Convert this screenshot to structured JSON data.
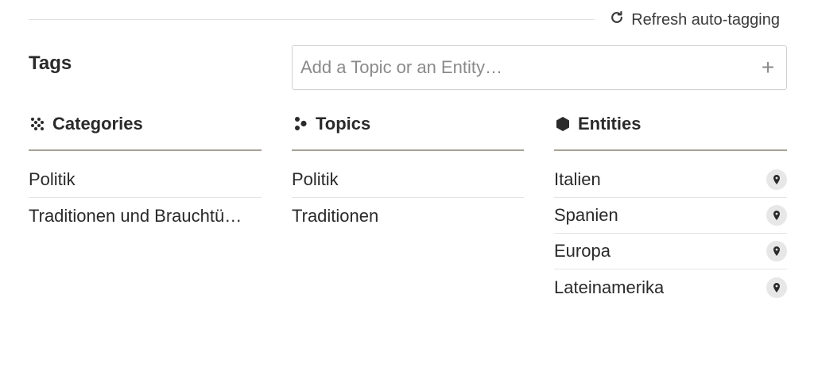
{
  "header": {
    "refresh_label": "Refresh auto-tagging",
    "refresh_icon": "refresh-icon"
  },
  "tags": {
    "title": "Tags",
    "input_placeholder": "Add a Topic or an Entity…",
    "add_icon": "plus-icon"
  },
  "categories": {
    "title": "Categories",
    "icon": "categories-dots-icon",
    "items": [
      "Politik",
      "Traditionen und Brauchtü…"
    ]
  },
  "topics": {
    "title": "Topics",
    "icon": "topics-icon",
    "items": [
      "Politik",
      "Traditionen"
    ]
  },
  "entities": {
    "title": "Entities",
    "icon": "hexagon-icon",
    "item_icon": "location-pin-icon",
    "items": [
      "Italien",
      "Spanien",
      "Europa",
      "Lateinamerika"
    ]
  },
  "colors": {
    "text": "#2a2a2a",
    "muted": "#8a8a8a",
    "rule": "#a6a396",
    "divider": "#e4e4e4",
    "pin_bg": "#e7e7e7"
  }
}
